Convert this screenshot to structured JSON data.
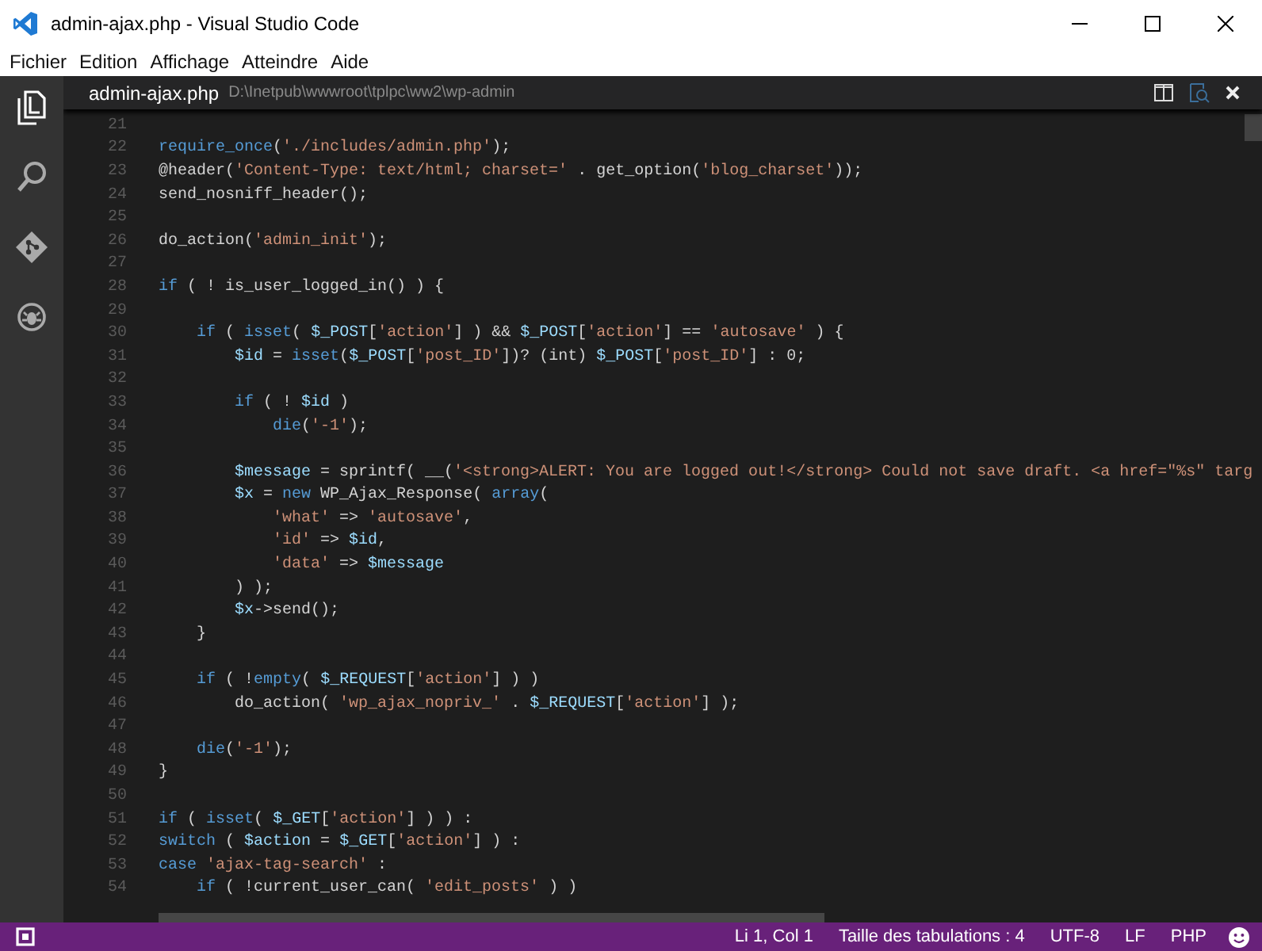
{
  "window": {
    "title": "admin-ajax.php - Visual Studio Code"
  },
  "menu": [
    "Fichier",
    "Edition",
    "Affichage",
    "Atteindre",
    "Aide"
  ],
  "editor_header": {
    "file_name": "admin-ajax.php",
    "path": "D:\\Inetpub\\wwwroot\\tplpc\\ww2\\wp-admin"
  },
  "lines": [
    {
      "number": "21"
    },
    {
      "number": "22",
      "tokens": [
        {
          "kind": "keyword",
          "text": "require_once"
        },
        {
          "kind": "plain",
          "text": "("
        },
        {
          "kind": "string",
          "text": "'./includes/admin.php'"
        },
        {
          "kind": "plain",
          "text": ");"
        }
      ]
    },
    {
      "number": "23",
      "tokens": [
        {
          "kind": "plain",
          "text": "@header("
        },
        {
          "kind": "string",
          "text": "'Content-Type: text/html; charset='"
        },
        {
          "kind": "plain",
          "text": " . get_option("
        },
        {
          "kind": "string",
          "text": "'blog_charset'"
        },
        {
          "kind": "plain",
          "text": "));"
        }
      ]
    },
    {
      "number": "24",
      "tokens": [
        {
          "kind": "plain",
          "text": "send_nosniff_header();"
        }
      ]
    },
    {
      "number": "25"
    },
    {
      "number": "26",
      "tokens": [
        {
          "kind": "plain",
          "text": "do_action("
        },
        {
          "kind": "string",
          "text": "'admin_init'"
        },
        {
          "kind": "plain",
          "text": ");"
        }
      ]
    },
    {
      "number": "27"
    },
    {
      "number": "28",
      "tokens": [
        {
          "kind": "keyword",
          "text": "if"
        },
        {
          "kind": "plain",
          "text": " ( ! is_user_logged_in() ) {"
        }
      ]
    },
    {
      "number": "29"
    },
    {
      "number": "30",
      "tokens": [
        {
          "kind": "keyword",
          "text": "    if"
        },
        {
          "kind": "plain",
          "text": " ( "
        },
        {
          "kind": "keyword",
          "text": "isset"
        },
        {
          "kind": "plain",
          "text": "( "
        },
        {
          "kind": "variable",
          "text": "$_POST"
        },
        {
          "kind": "plain",
          "text": "["
        },
        {
          "kind": "string",
          "text": "'action'"
        },
        {
          "kind": "plain",
          "text": "] ) && "
        },
        {
          "kind": "variable",
          "text": "$_POST"
        },
        {
          "kind": "plain",
          "text": "["
        },
        {
          "kind": "string",
          "text": "'action'"
        },
        {
          "kind": "plain",
          "text": "] == "
        },
        {
          "kind": "string",
          "text": "'autosave'"
        },
        {
          "kind": "plain",
          "text": " ) {"
        }
      ]
    },
    {
      "number": "31",
      "tokens": [
        {
          "kind": "variable",
          "text": "        $id"
        },
        {
          "kind": "plain",
          "text": " = "
        },
        {
          "kind": "keyword",
          "text": "isset"
        },
        {
          "kind": "plain",
          "text": "("
        },
        {
          "kind": "variable",
          "text": "$_POST"
        },
        {
          "kind": "plain",
          "text": "["
        },
        {
          "kind": "string",
          "text": "'post_ID'"
        },
        {
          "kind": "plain",
          "text": "])? (int) "
        },
        {
          "kind": "variable",
          "text": "$_POST"
        },
        {
          "kind": "plain",
          "text": "["
        },
        {
          "kind": "string",
          "text": "'post_ID'"
        },
        {
          "kind": "plain",
          "text": "] : 0;"
        }
      ]
    },
    {
      "number": "32"
    },
    {
      "number": "33",
      "tokens": [
        {
          "kind": "keyword",
          "text": "        if"
        },
        {
          "kind": "plain",
          "text": " ( ! "
        },
        {
          "kind": "variable",
          "text": "$id"
        },
        {
          "kind": "plain",
          "text": " )"
        }
      ]
    },
    {
      "number": "34",
      "tokens": [
        {
          "kind": "keyword",
          "text": "            die"
        },
        {
          "kind": "plain",
          "text": "("
        },
        {
          "kind": "string",
          "text": "'-1'"
        },
        {
          "kind": "plain",
          "text": ");"
        }
      ]
    },
    {
      "number": "35"
    },
    {
      "number": "36",
      "tokens": [
        {
          "kind": "variable",
          "text": "        $message"
        },
        {
          "kind": "plain",
          "text": " = sprintf( __("
        },
        {
          "kind": "string",
          "text": "'<strong>ALERT: You are logged out!</strong> Could not save draft. <a href=\"%s\" targ"
        }
      ]
    },
    {
      "number": "37",
      "tokens": [
        {
          "kind": "variable",
          "text": "        $x"
        },
        {
          "kind": "plain",
          "text": " = "
        },
        {
          "kind": "keyword",
          "text": "new"
        },
        {
          "kind": "plain",
          "text": " WP_Ajax_Response( "
        },
        {
          "kind": "keyword",
          "text": "array"
        },
        {
          "kind": "plain",
          "text": "("
        }
      ]
    },
    {
      "number": "38",
      "tokens": [
        {
          "kind": "string",
          "text": "            'what'"
        },
        {
          "kind": "plain",
          "text": " => "
        },
        {
          "kind": "string",
          "text": "'autosave'"
        },
        {
          "kind": "plain",
          "text": ","
        }
      ]
    },
    {
      "number": "39",
      "tokens": [
        {
          "kind": "string",
          "text": "            'id'"
        },
        {
          "kind": "plain",
          "text": " => "
        },
        {
          "kind": "variable",
          "text": "$id"
        },
        {
          "kind": "plain",
          "text": ","
        }
      ]
    },
    {
      "number": "40",
      "tokens": [
        {
          "kind": "string",
          "text": "            'data'"
        },
        {
          "kind": "plain",
          "text": " => "
        },
        {
          "kind": "variable",
          "text": "$message"
        }
      ]
    },
    {
      "number": "41",
      "tokens": [
        {
          "kind": "plain",
          "text": "        ) );"
        }
      ]
    },
    {
      "number": "42",
      "tokens": [
        {
          "kind": "variable",
          "text": "        $x"
        },
        {
          "kind": "plain",
          "text": "->send();"
        }
      ]
    },
    {
      "number": "43",
      "tokens": [
        {
          "kind": "plain",
          "text": "    }"
        }
      ]
    },
    {
      "number": "44"
    },
    {
      "number": "45",
      "tokens": [
        {
          "kind": "keyword",
          "text": "    if"
        },
        {
          "kind": "plain",
          "text": " ( !"
        },
        {
          "kind": "keyword",
          "text": "empty"
        },
        {
          "kind": "plain",
          "text": "( "
        },
        {
          "kind": "variable",
          "text": "$_REQUEST"
        },
        {
          "kind": "plain",
          "text": "["
        },
        {
          "kind": "string",
          "text": "'action'"
        },
        {
          "kind": "plain",
          "text": "] ) )"
        }
      ]
    },
    {
      "number": "46",
      "tokens": [
        {
          "kind": "plain",
          "text": "        do_action( "
        },
        {
          "kind": "string",
          "text": "'wp_ajax_nopriv_'"
        },
        {
          "kind": "plain",
          "text": " . "
        },
        {
          "kind": "variable",
          "text": "$_REQUEST"
        },
        {
          "kind": "plain",
          "text": "["
        },
        {
          "kind": "string",
          "text": "'action'"
        },
        {
          "kind": "plain",
          "text": "] );"
        }
      ]
    },
    {
      "number": "47"
    },
    {
      "number": "48",
      "tokens": [
        {
          "kind": "keyword",
          "text": "    die"
        },
        {
          "kind": "plain",
          "text": "("
        },
        {
          "kind": "string",
          "text": "'-1'"
        },
        {
          "kind": "plain",
          "text": ");"
        }
      ]
    },
    {
      "number": "49",
      "tokens": [
        {
          "kind": "plain",
          "text": "}"
        }
      ]
    },
    {
      "number": "50"
    },
    {
      "number": "51",
      "tokens": [
        {
          "kind": "keyword",
          "text": "if"
        },
        {
          "kind": "plain",
          "text": " ( "
        },
        {
          "kind": "keyword",
          "text": "isset"
        },
        {
          "kind": "plain",
          "text": "( "
        },
        {
          "kind": "variable",
          "text": "$_GET"
        },
        {
          "kind": "plain",
          "text": "["
        },
        {
          "kind": "string",
          "text": "'action'"
        },
        {
          "kind": "plain",
          "text": "] ) ) :"
        }
      ]
    },
    {
      "number": "52",
      "tokens": [
        {
          "kind": "keyword",
          "text": "switch"
        },
        {
          "kind": "plain",
          "text": " ( "
        },
        {
          "kind": "variable",
          "text": "$action"
        },
        {
          "kind": "plain",
          "text": " = "
        },
        {
          "kind": "variable",
          "text": "$_GET"
        },
        {
          "kind": "plain",
          "text": "["
        },
        {
          "kind": "string",
          "text": "'action'"
        },
        {
          "kind": "plain",
          "text": "] ) :"
        }
      ]
    },
    {
      "number": "53",
      "tokens": [
        {
          "kind": "keyword",
          "text": "case"
        },
        {
          "kind": "string",
          "text": " 'ajax-tag-search'"
        },
        {
          "kind": "plain",
          "text": " :"
        }
      ]
    },
    {
      "number": "54",
      "tokens": [
        {
          "kind": "keyword",
          "text": "    if"
        },
        {
          "kind": "plain",
          "text": " ( !current_user_can( "
        },
        {
          "kind": "string",
          "text": "'edit_posts'"
        },
        {
          "kind": "plain",
          "text": " ) )"
        }
      ]
    }
  ],
  "status_bar": {
    "items": [
      "Li 1, Col 1",
      "Taille des tabulations : 4",
      "UTF-8",
      "LF",
      "PHP"
    ]
  }
}
